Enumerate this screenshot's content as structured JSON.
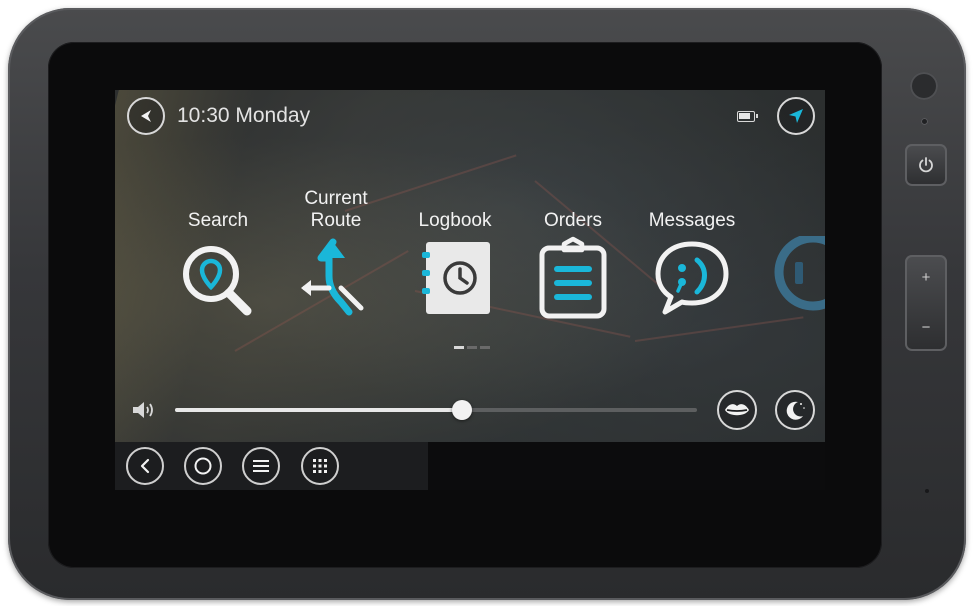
{
  "status_bar": {
    "time_day": "10:30 Monday",
    "battery_level": 0.85
  },
  "apps": [
    {
      "label": "Search",
      "icon": "search-icon"
    },
    {
      "label": "Current\nRoute",
      "icon": "current-route-icon"
    },
    {
      "label": "Logbook",
      "icon": "logbook-icon"
    },
    {
      "label": "Orders",
      "icon": "orders-icon"
    },
    {
      "label": "Messages",
      "icon": "messages-icon"
    },
    {
      "label": "",
      "icon": "partial-app-icon"
    }
  ],
  "pager": {
    "pages": 3,
    "current": 1
  },
  "volume": {
    "level": 0.55
  },
  "bottom_nav": [
    "back-icon",
    "home-icon",
    "menu-icon",
    "apps-grid-icon"
  ],
  "hardware": {
    "volume_plus": "+",
    "volume_minus": "−"
  },
  "colors": {
    "accent": "#1ab7d9",
    "icon_white": "#f2f2f2",
    "screen_bg": "#1a1c1e"
  }
}
